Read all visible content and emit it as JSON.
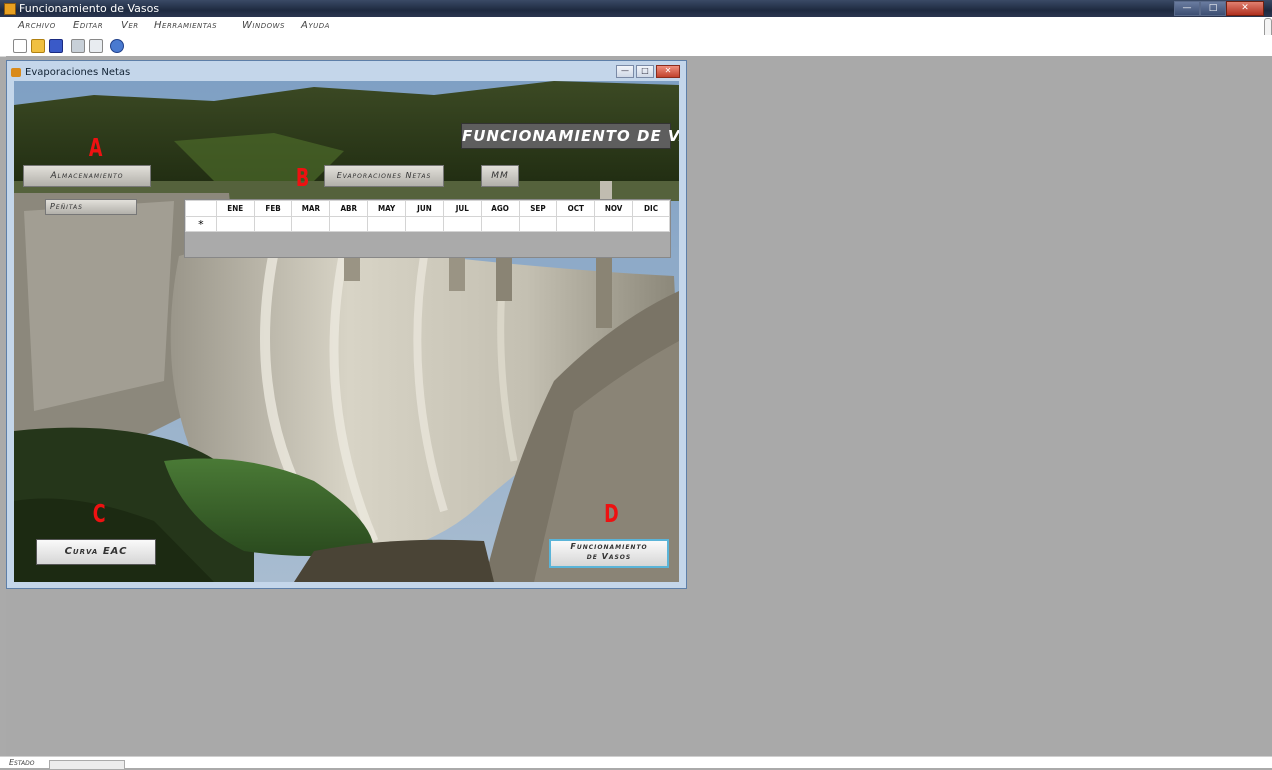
{
  "window": {
    "title": "Funcionamiento de Vasos",
    "controls": [
      "—",
      "□",
      "✕"
    ]
  },
  "menu": [
    "Archivo",
    "Editar",
    "Ver",
    "Herramientas",
    "Windows",
    "Ayuda"
  ],
  "toolbar": {
    "icons": [
      "new-file-icon",
      "open-folder-icon",
      "save-icon",
      "print-icon",
      "print-preview-icon",
      "help-icon"
    ]
  },
  "child": {
    "title": "Evaporaciones Netas",
    "controls": [
      "—",
      "□",
      "✕"
    ],
    "heading": "FUNCIONAMIENTO DE VASOS",
    "almacenamiento": "Almacenamiento",
    "penitas": "Peñitas",
    "evaporaciones": "Evaporaciones Netas",
    "unit": "MM",
    "markers": [
      "A",
      "B",
      "C",
      "D"
    ],
    "grid": {
      "columns": [
        "ENE",
        "FEB",
        "MAR",
        "ABR",
        "MAY",
        "JUN",
        "JUL",
        "AGO",
        "SEP",
        "OCT",
        "NOV",
        "DIC"
      ],
      "new_row_symbol": "*"
    },
    "btn_curva": "Curva EAC",
    "btn_funcionamiento_1": "Funcionamiento",
    "btn_funcionamiento_2": "de Vasos"
  },
  "status": {
    "label": "Estado"
  },
  "colors": {
    "marker": "#ee1111",
    "sky": "#7fa0c4",
    "forest": "#2c3a1a",
    "dam": "#c8c4b6",
    "water": "#3c6a2e"
  }
}
